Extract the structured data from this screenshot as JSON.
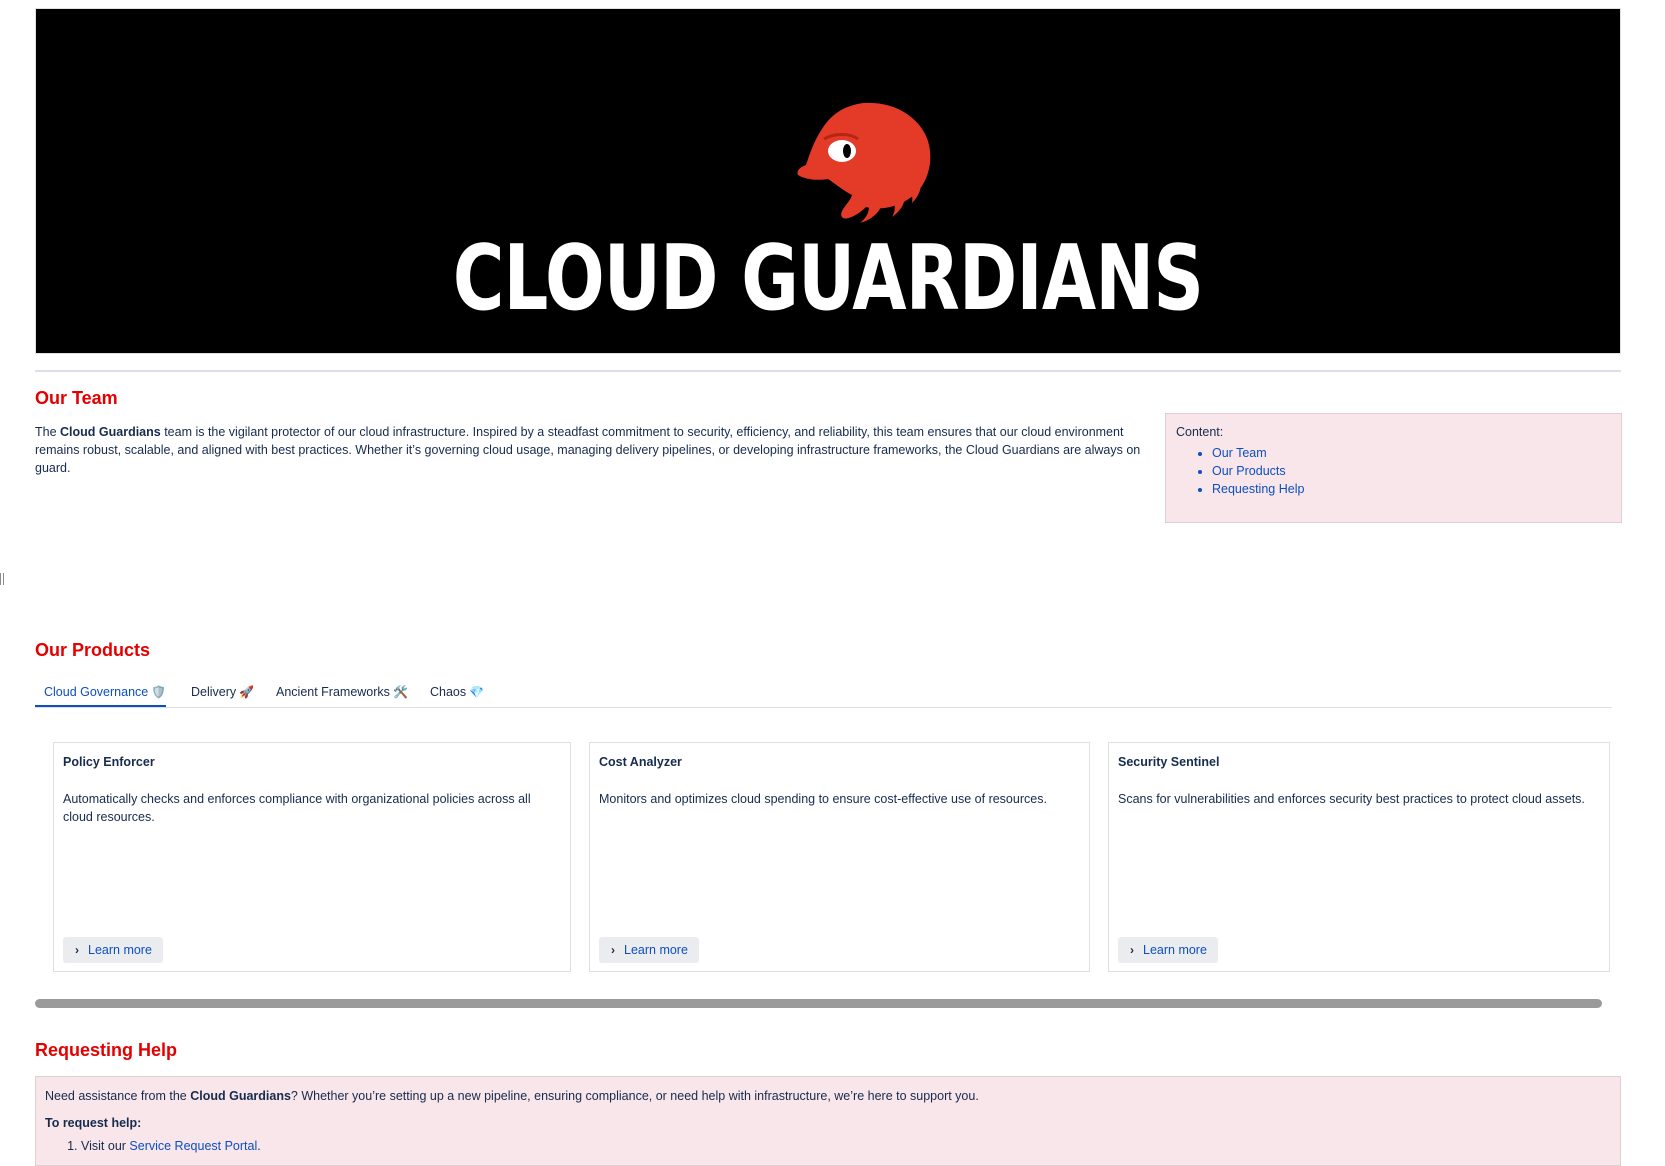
{
  "banner": {
    "title": "CLOUD GUARDIANS",
    "logo_icon": "red-echidna-head-icon",
    "background": "#000000",
    "logo_color": "#e33b28"
  },
  "team": {
    "heading": "Our Team",
    "text_before": "The ",
    "text_bold": "Cloud Guardians",
    "text_after": " team is the vigilant protector of our cloud infrastructure. Inspired by a steadfast commitment to security, efficiency, and reliability, this team ensures that our cloud environment remains robust, scalable, and aligned with best practices. Whether it’s governing cloud usage, managing delivery pipelines, or developing infrastructure frameworks, the Cloud Guardians are always on guard."
  },
  "toc": {
    "label": "Content:",
    "items": [
      "Our Team",
      "Our Products",
      "Requesting Help"
    ]
  },
  "products": {
    "heading": "Our Products",
    "tabs": [
      {
        "label": "Cloud Governance",
        "icon": "🛡️",
        "active": true
      },
      {
        "label": "Delivery",
        "icon": "🚀",
        "active": false
      },
      {
        "label": "Ancient Frameworks",
        "icon": "🛠️",
        "active": false
      },
      {
        "label": "Chaos",
        "icon": "💎",
        "active": false
      }
    ],
    "cards": [
      {
        "title": "Policy Enforcer",
        "description": "Automatically checks and enforces compliance with organizational policies across all cloud resources.",
        "button": "Learn more"
      },
      {
        "title": "Cost Analyzer",
        "description": "Monitors and optimizes cloud spending to ensure cost-effective use of resources.",
        "button": "Learn more"
      },
      {
        "title": "Security Sentinel",
        "description": "Scans for vulnerabilities and enforces security best practices to protect cloud assets.",
        "button": "Learn more"
      }
    ]
  },
  "help": {
    "heading": "Requesting Help",
    "intro_before": "Need assistance from the ",
    "intro_bold": "Cloud Guardians",
    "intro_after": "? Whether you’re setting up a new pipeline, ensuring compliance, or need help with infrastructure, we’re here to support you.",
    "subheading": "To request help:",
    "step1_before": "Visit our ",
    "step1_link": "Service Request Portal",
    "step1_after": "."
  },
  "colors": {
    "accent_red": "#e50000",
    "link_blue": "#0c4fbf",
    "panel_pink": "#f8e6ea"
  }
}
